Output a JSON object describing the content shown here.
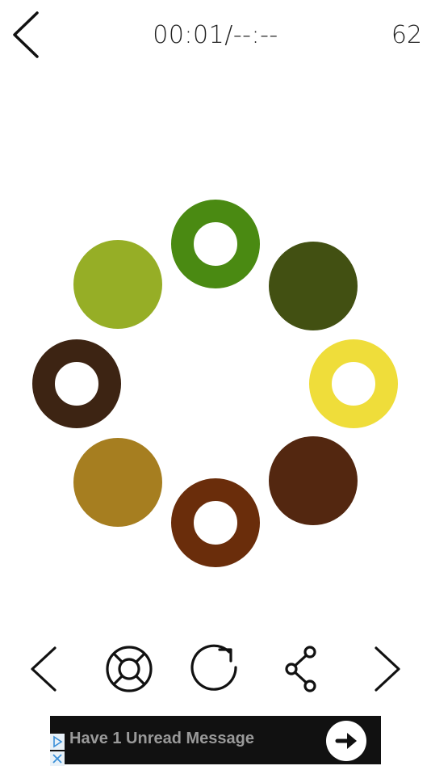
{
  "header": {
    "timer": "00:01/--:--",
    "moves": "62"
  },
  "pieces": [
    {
      "id": "top",
      "color": "#4a8a12",
      "shape": "ring"
    },
    {
      "id": "upper-right",
      "color": "#425012",
      "shape": "dot"
    },
    {
      "id": "right",
      "color": "#efdd3a",
      "shape": "ring"
    },
    {
      "id": "lower-right",
      "color": "#532710",
      "shape": "dot"
    },
    {
      "id": "bottom",
      "color": "#6a2d0b",
      "shape": "ring"
    },
    {
      "id": "lower-left",
      "color": "#a67e20",
      "shape": "dot"
    },
    {
      "id": "left",
      "color": "#3d2413",
      "shape": "ring"
    },
    {
      "id": "upper-left",
      "color": "#96ae26",
      "shape": "dot"
    }
  ],
  "toolbar": [
    {
      "id": "previous",
      "icon": "chevron-left-icon"
    },
    {
      "id": "help",
      "icon": "lifebuoy-icon"
    },
    {
      "id": "restart",
      "icon": "restart-icon"
    },
    {
      "id": "share",
      "icon": "share-icon"
    },
    {
      "id": "next",
      "icon": "chevron-right-icon"
    }
  ],
  "ad": {
    "text": "Have 1 Unread Message"
  }
}
